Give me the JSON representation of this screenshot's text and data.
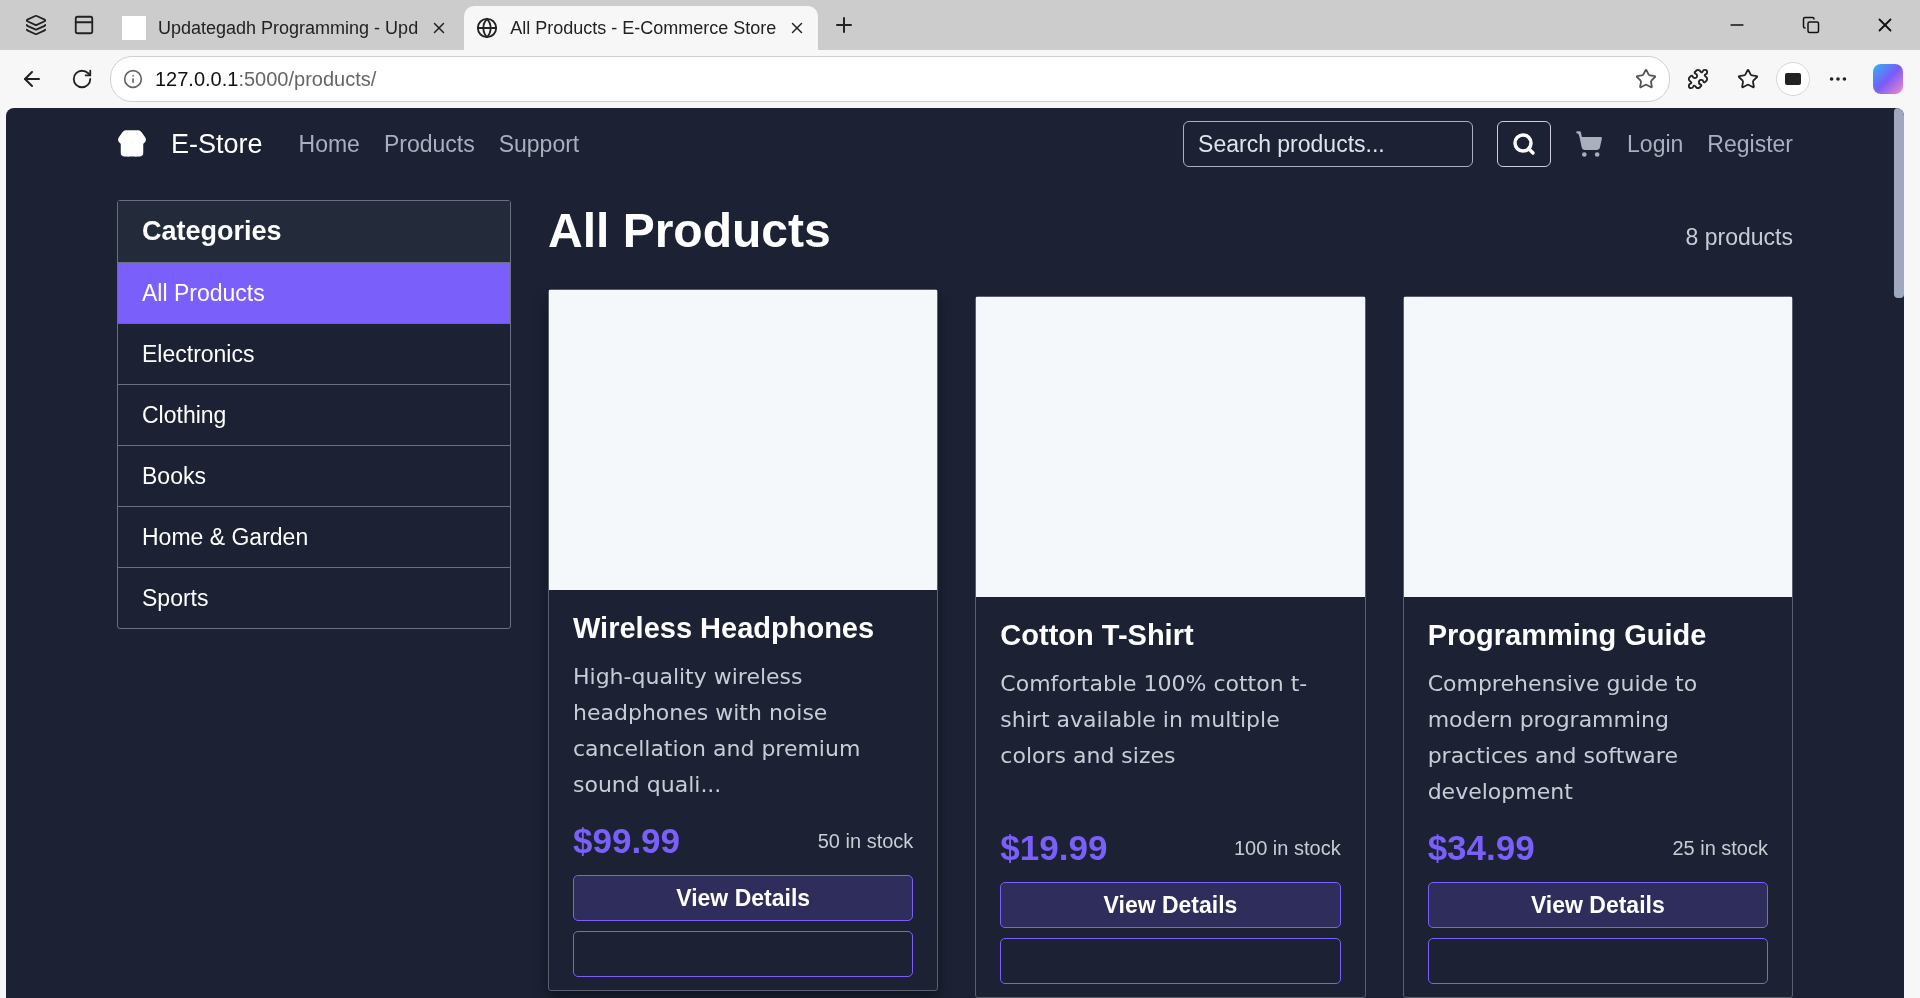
{
  "browser": {
    "tabs": [
      {
        "title": "Updategadh Programming - Upd",
        "selected": false,
        "kind": "logo"
      },
      {
        "title": "All Products - E-Commerce Store",
        "selected": true,
        "kind": "globe"
      }
    ],
    "address": {
      "host": "127.0.0.1",
      "rest": ":5000/products/"
    }
  },
  "navbar": {
    "brand": "E-Store",
    "links": [
      "Home",
      "Products",
      "Support"
    ],
    "search": {
      "placeholder": "Search products..."
    },
    "account_links": [
      "Login",
      "Register"
    ]
  },
  "sidebar": {
    "title": "Categories",
    "items": [
      {
        "label": "All Products",
        "selected": true
      },
      {
        "label": "Electronics",
        "selected": false
      },
      {
        "label": "Clothing",
        "selected": false
      },
      {
        "label": "Books",
        "selected": false
      },
      {
        "label": "Home & Garden",
        "selected": false
      },
      {
        "label": "Sports",
        "selected": false
      }
    ]
  },
  "main": {
    "title": "All Products",
    "count": "8 products",
    "products": [
      {
        "name": "Wireless Headphones",
        "description": "High-quality wireless headphones with noise cancellation and premium sound quali...",
        "price": "$99.99",
        "stock": "50 in stock",
        "button": "View Details",
        "raised": true
      },
      {
        "name": "Cotton T-Shirt",
        "description": "Comfortable 100% cotton t-shirt available in multiple colors and sizes",
        "price": "$19.99",
        "stock": "100 in stock",
        "button": "View Details",
        "raised": false
      },
      {
        "name": "Programming Guide",
        "description": "Comprehensive guide to modern programming practices and software development",
        "price": "$34.99",
        "stock": "25 in stock",
        "button": "View Details",
        "raised": false
      }
    ]
  }
}
